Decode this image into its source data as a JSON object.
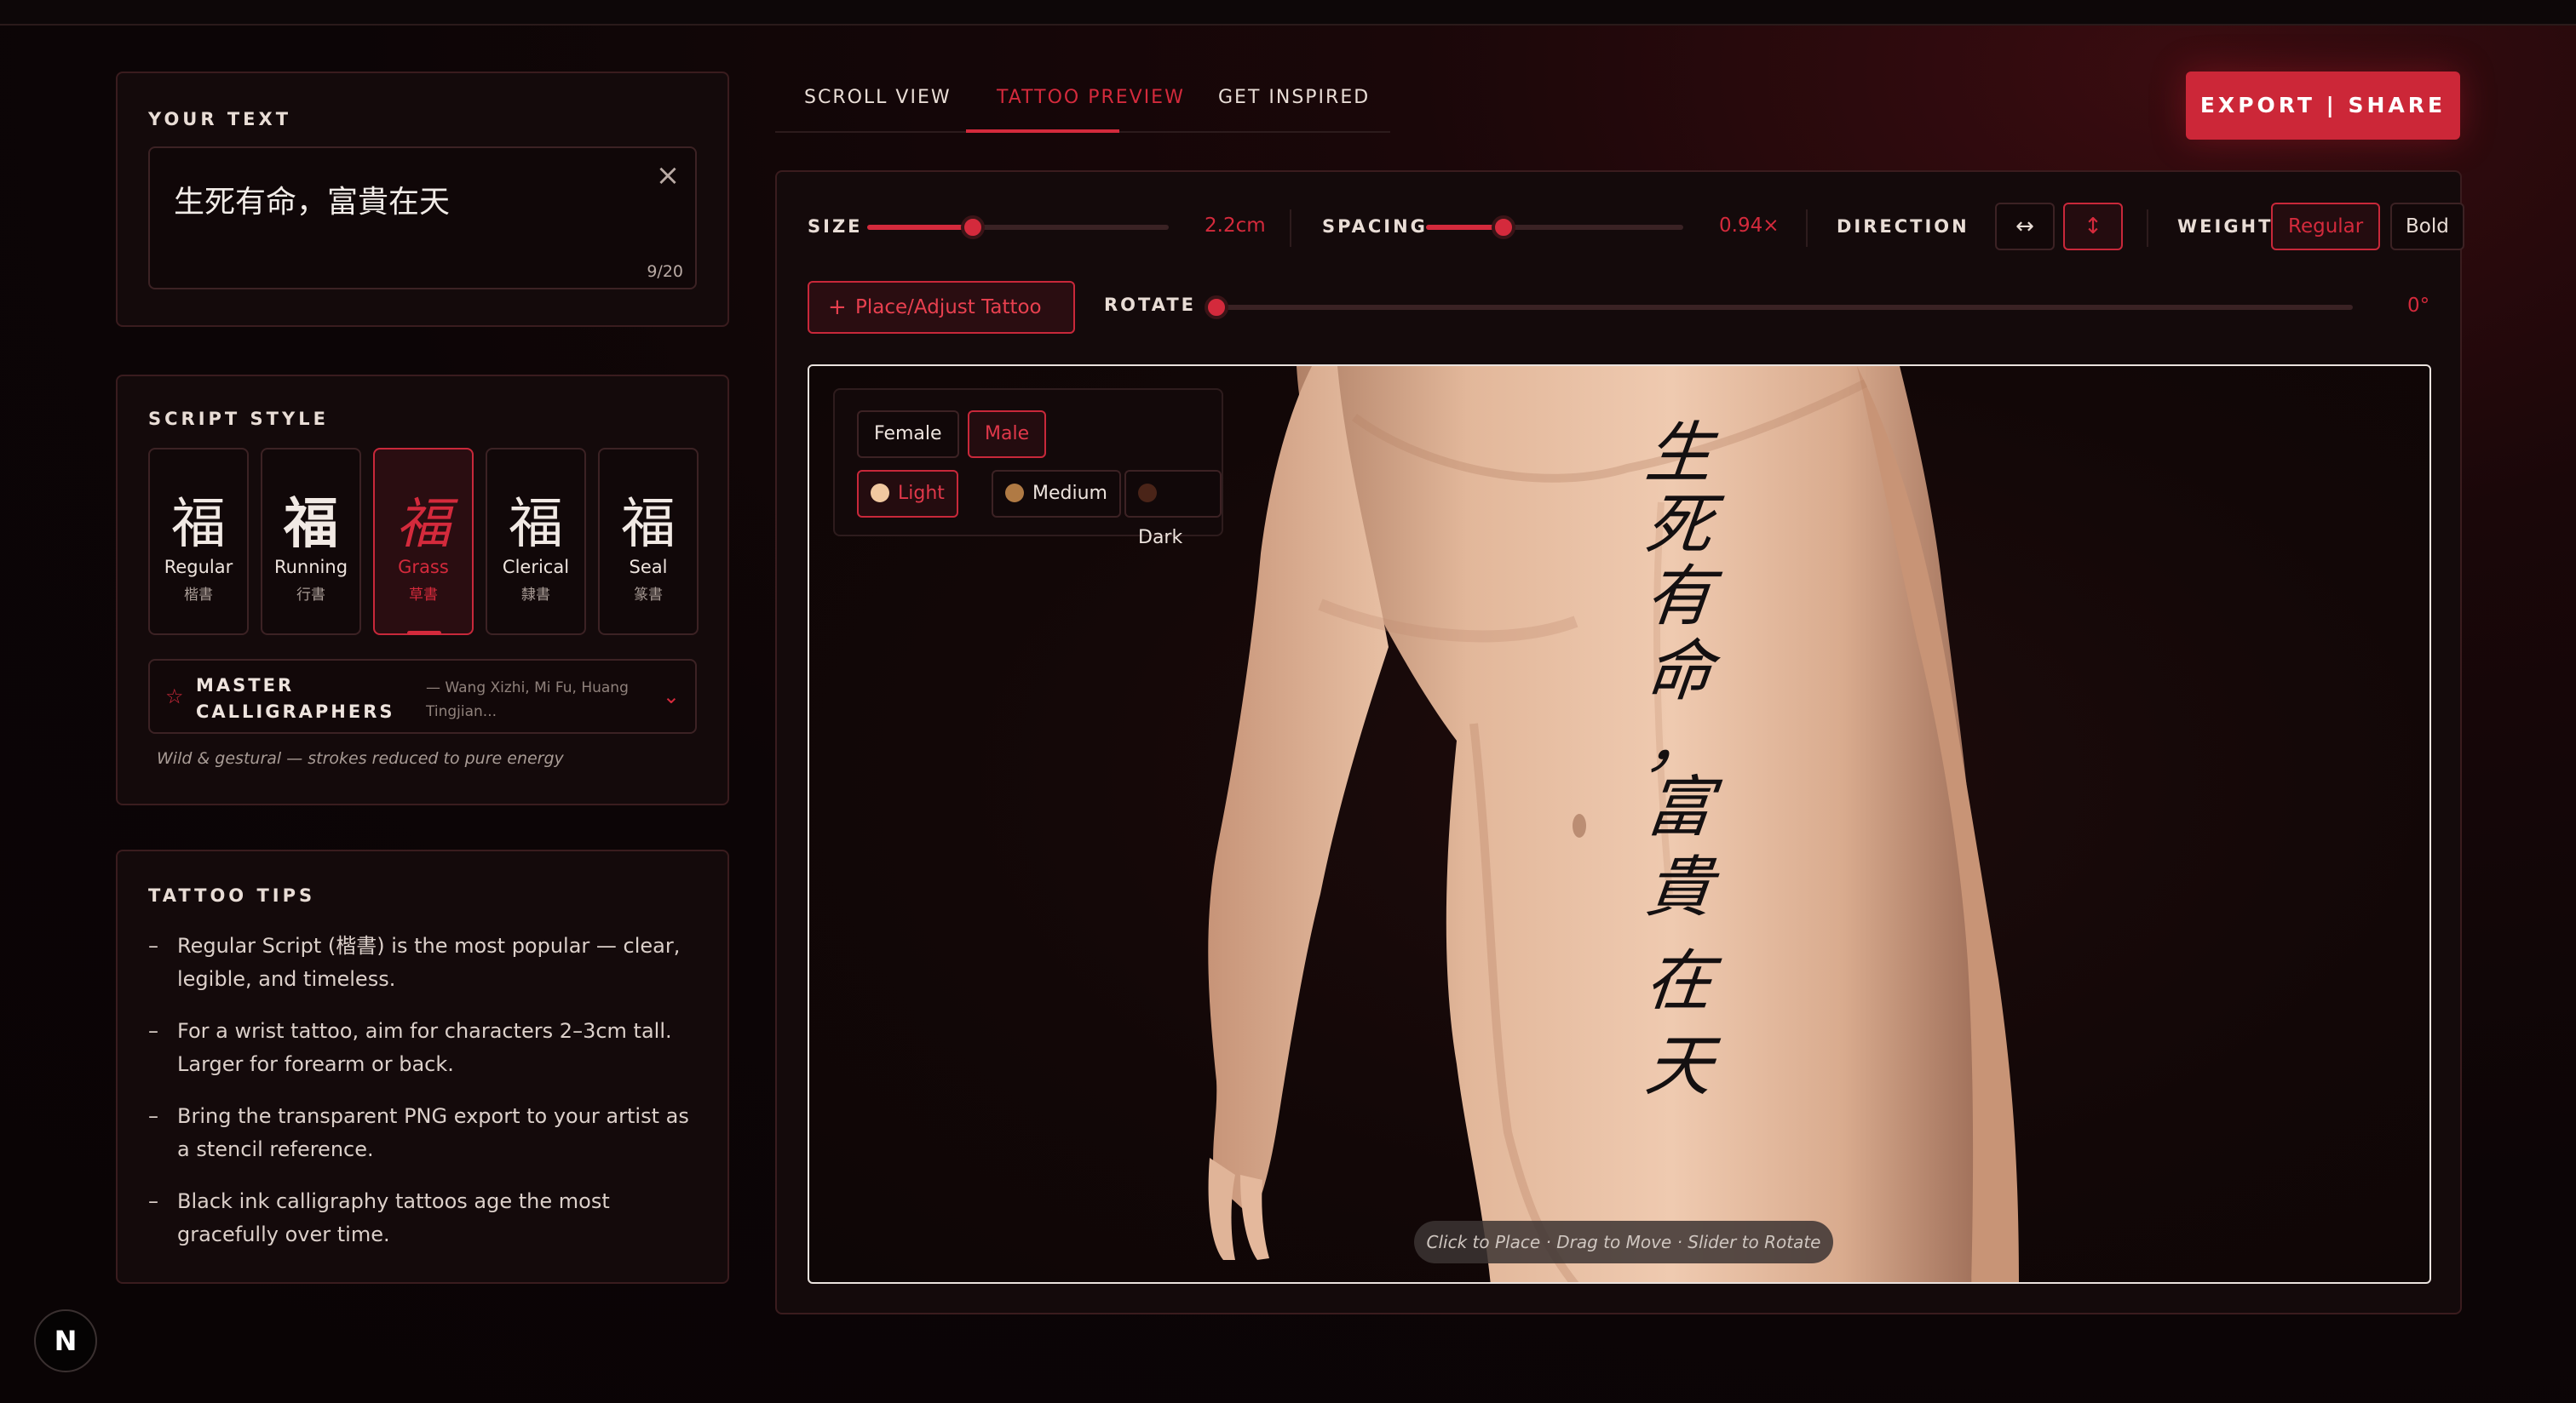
{
  "your_text": {
    "label": "YOUR TEXT",
    "value": "生死有命，富貴在天",
    "clear_icon": "close-icon",
    "count": "9/20"
  },
  "script_style": {
    "label": "SCRIPT STYLE",
    "styles": [
      {
        "glyph": "福",
        "name": "Regular",
        "zh": "楷書",
        "active": false
      },
      {
        "glyph": "福",
        "name": "Running",
        "zh": "行書",
        "active": false
      },
      {
        "glyph": "福",
        "name": "Grass",
        "zh": "草書",
        "active": true
      },
      {
        "glyph": "福",
        "name": "Clerical",
        "zh": "隸書",
        "active": false
      },
      {
        "glyph": "福",
        "name": "Seal",
        "zh": "篆書",
        "active": false
      }
    ],
    "masters_label": "MASTER CALLIGRAPHERS",
    "masters_names": "— Wang Xizhi, Mi Fu, Huang Tingjian...",
    "description": "Wild & gestural — strokes reduced to pure energy"
  },
  "tips": {
    "label": "TATTOO TIPS",
    "items": [
      "Regular Script (楷書) is the most popular — clear, legible, and timeless.",
      "For a wrist tattoo, aim for characters 2–3cm tall. Larger for forearm or back.",
      "Bring the transparent PNG export to your artist as a stencil reference.",
      "Black ink calligraphy tattoos age the most gracefully over time."
    ]
  },
  "tabs": [
    {
      "label": "SCROLL VIEW",
      "active": false
    },
    {
      "label": "TATTOO PREVIEW",
      "active": true
    },
    {
      "label": "GET INSPIRED",
      "active": false
    }
  ],
  "export_label": "EXPORT | SHARE",
  "controls": {
    "size": {
      "label": "SIZE",
      "value": "2.2cm",
      "fraction": 0.35
    },
    "spacing": {
      "label": "SPACING",
      "value": "0.94×",
      "fraction": 0.3
    },
    "direction": {
      "label": "DIRECTION",
      "horizontal_icon": "arrows-horizontal-icon",
      "vertical_icon": "arrows-vertical-icon",
      "active": "vertical"
    },
    "weight": {
      "label": "WEIGHT",
      "options": [
        "Regular",
        "Bold"
      ],
      "active": "Regular"
    },
    "place_label": "Place/Adjust Tattoo",
    "rotate": {
      "label": "ROTATE",
      "value": "0°",
      "fraction": 0.0
    }
  },
  "preview": {
    "genders": [
      {
        "label": "Female",
        "active": false
      },
      {
        "label": "Male",
        "active": true
      }
    ],
    "skins": [
      {
        "label": "Light",
        "color": "#f0c8a0",
        "active": true
      },
      {
        "label": "Medium",
        "color": "#b07a44",
        "active": false
      },
      {
        "label": "Dark",
        "color": "#4a2418",
        "active": false
      }
    ],
    "tattoo_chars": [
      "生",
      "死",
      "有",
      "命",
      "，",
      "富",
      "貴",
      "在",
      "天"
    ],
    "hint": "Click to Place · Drag to Move · Slider to Rotate"
  },
  "badge": "N"
}
